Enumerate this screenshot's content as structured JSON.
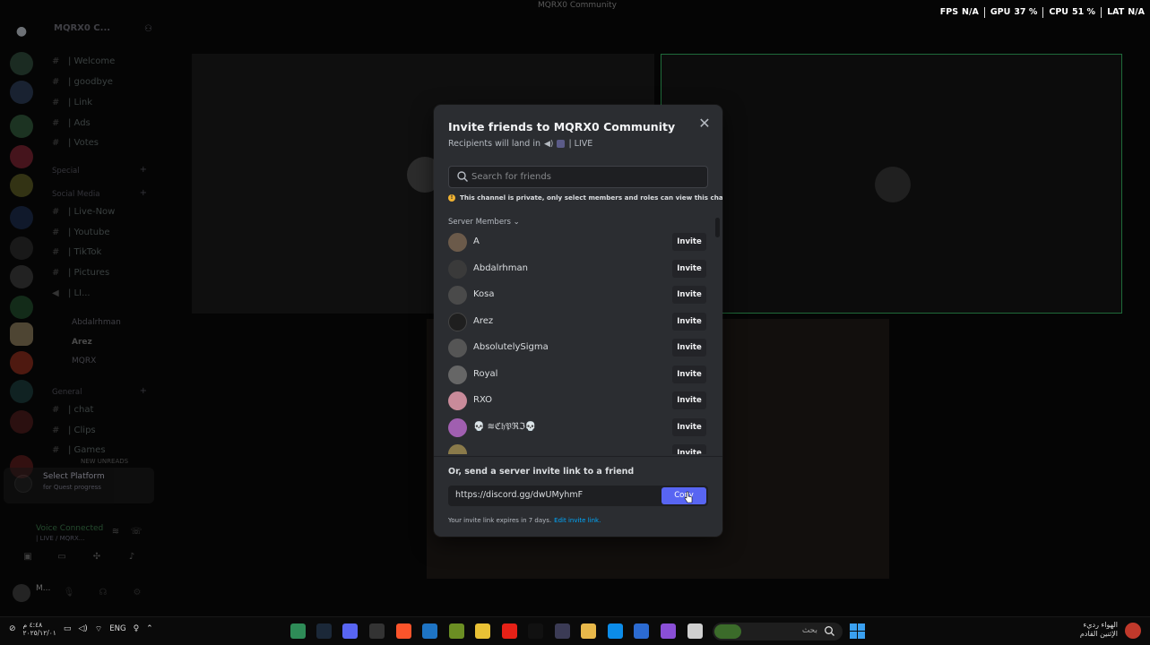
{
  "window": {
    "title": "MQRX0 Community"
  },
  "perf_overlay": [
    {
      "label": "FPS",
      "value": "N/A"
    },
    {
      "label": "GPU",
      "value": "37 %"
    },
    {
      "label": "CPU",
      "value": "51 %"
    },
    {
      "label": "LAT",
      "value": "N/A"
    }
  ],
  "sidebar": {
    "server_name": "MQRX0 C...",
    "channels": [
      {
        "name": "| Welcome"
      },
      {
        "name": "| goodbye"
      },
      {
        "name": "| Link"
      },
      {
        "name": "| Ads"
      },
      {
        "name": "| Votes"
      }
    ],
    "categories": [
      "Special",
      "Social Media",
      "General"
    ],
    "social_channels": [
      {
        "name": "| Live-Now"
      },
      {
        "name": "| Youtube"
      },
      {
        "name": "| TikTok"
      },
      {
        "name": "| Pictures"
      }
    ],
    "voice_channel": "| LI...",
    "voice_users": [
      "Abdalrhman",
      "Arez",
      "MQRX"
    ],
    "general_channels": [
      {
        "name": "| chat"
      },
      {
        "name": "| Clips"
      },
      {
        "name": "| Games"
      }
    ],
    "new_unreads": "NEW UNREADS",
    "select_platform": {
      "title": "Select Platform",
      "subtitle": "for Quest progress"
    },
    "voice_connected": {
      "title": "Voice Connected",
      "subtitle": "| LIVE / MQRX..."
    },
    "user": "M..."
  },
  "modal": {
    "title": "Invite friends to MQRX0 Community",
    "subtitle_prefix": "Recipients will land in",
    "subtitle_channel": "| LIVE",
    "search_placeholder": "Search for friends",
    "notice": "This channel is private, only select members and roles can view this channel.",
    "members_header": "Server Members ⌄",
    "invite_label": "Invite",
    "members": [
      {
        "name": "A",
        "color": "#6b5a4a"
      },
      {
        "name": "Abdalrhman",
        "color": "#3a3a3a"
      },
      {
        "name": "Kosa",
        "color": "#4a4a4a"
      },
      {
        "name": "Arez",
        "color": "#2a2a2a"
      },
      {
        "name": "AbsolutelySigma",
        "color": "#555555"
      },
      {
        "name": "Royal",
        "color": "#666666"
      },
      {
        "name": "RXO",
        "color": "#c98b9a"
      },
      {
        "name": "💀 ≋ℭ𝔥𝔓ℜℑ💀",
        "color": "#a05fb0"
      }
    ],
    "link_label": "Or, send a server invite link to a friend",
    "invite_url": "https://discord.gg/dwUMyhmF",
    "copy_label": "Copy",
    "expire_text": "Your invite link expires in 7 days.",
    "edit_link": "Edit invite link."
  },
  "taskbar": {
    "time_line1": "٤:٤٨ م",
    "time_line2": "٢٠٢٥/١٢/٠١",
    "lang": "ENG",
    "search_text": "بحث",
    "news_line1": "الهواء رديء",
    "news_line2": "الإثنين القادم"
  }
}
